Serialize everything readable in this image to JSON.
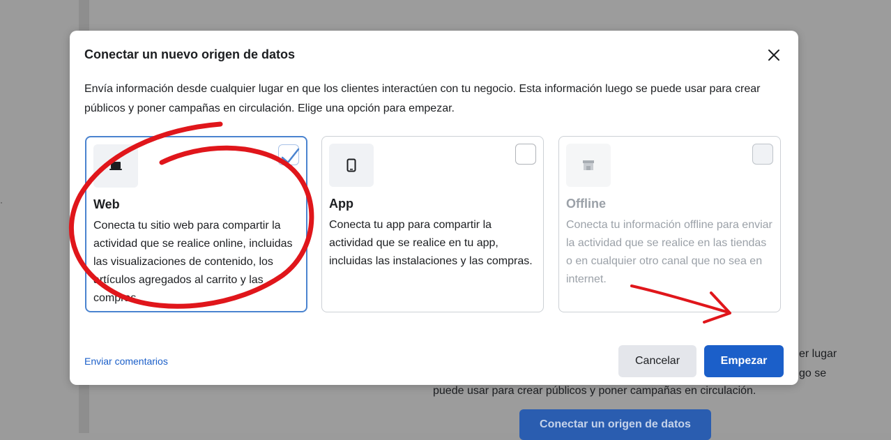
{
  "background": {
    "text_lines": [
      "er lugar",
      "go se",
      "puede usar para crear públicos y poner campañas en circulación."
    ],
    "connect_button": "Conectar un origen de datos"
  },
  "modal": {
    "title": "Conectar un nuevo origen de datos",
    "description": "Envía información desde cualquier lugar en que los clientes interactúen con tu negocio. Esta información luego se puede usar para crear públicos y poner campañas en circulación. Elige una opción para empezar.",
    "close_icon": "close-icon",
    "cards": [
      {
        "title": "Web",
        "description": "Conecta tu sitio web para compartir la actividad que se realice online, incluidas las visualizaciones de contenido, los artículos agregados al carrito y las compras.",
        "icon": "laptop-icon",
        "selected": true
      },
      {
        "title": "App",
        "description": "Conecta tu app para compartir la actividad que se realice en tu app, incluidas las instalaciones y las compras.",
        "icon": "phone-icon",
        "selected": false
      },
      {
        "title": "Offline",
        "description": "Conecta tu información offline para enviar la actividad que se realice en las tiendas o en cualquier otro canal que no sea en internet.",
        "icon": "store-icon",
        "selected": false,
        "disabled": true
      }
    ],
    "feedback_link": "Enviar comentarios",
    "cancel_button": "Cancelar",
    "start_button": "Empezar"
  },
  "colors": {
    "primary": "#1b5fc9",
    "selected_border": "#4a83cf",
    "annotation": "#e0161b"
  }
}
